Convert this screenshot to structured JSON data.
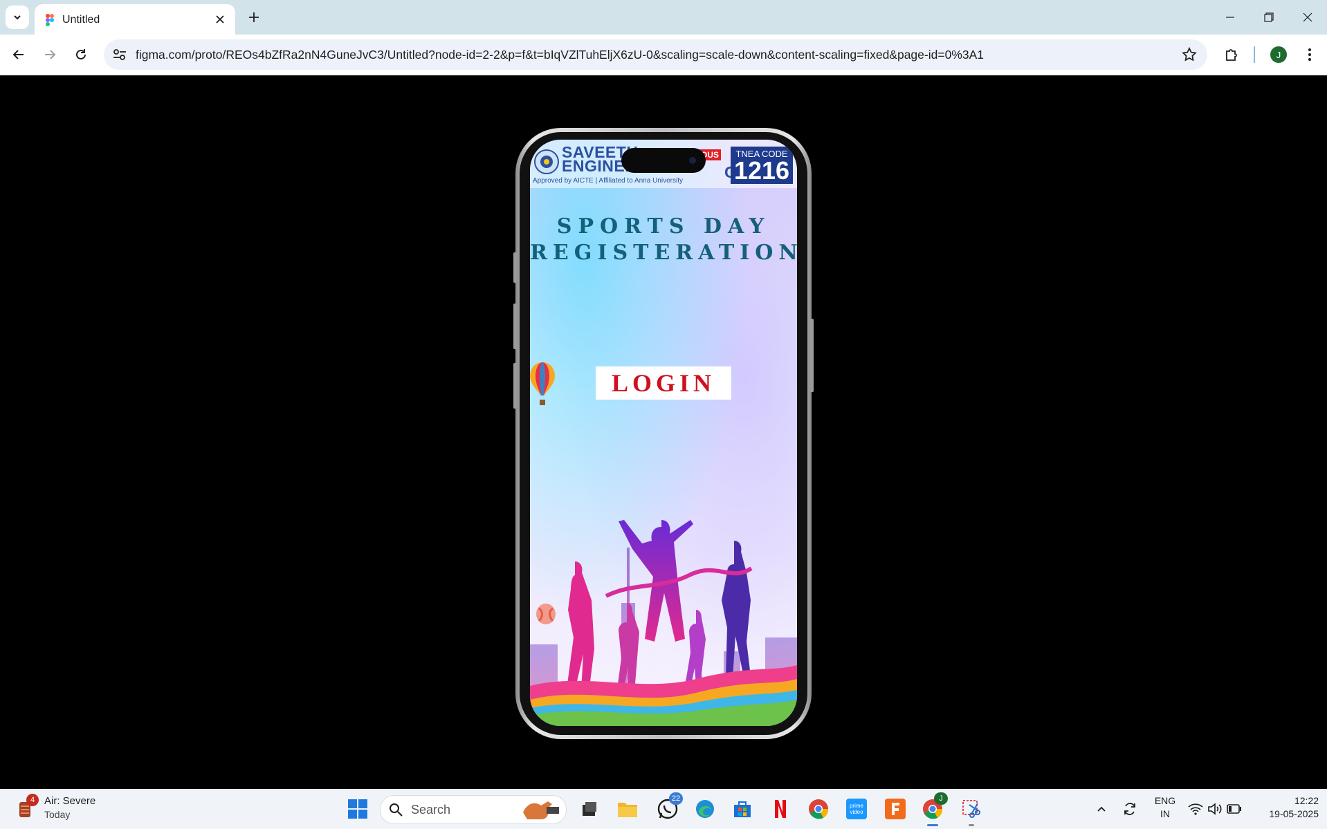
{
  "browser": {
    "tab_title": "Untitled",
    "url": "figma.com/proto/REOs4bZfRa2nN4GuneJvC3/Untitled?node-id=2-2&p=f&t=bIqVZlTuhEljX6zU-0&scaling=scale-down&content-scaling=fixed&page-id=0%3A1",
    "profile_initial": "J"
  },
  "phone_screen": {
    "college": {
      "name_line1": "SAVEETH",
      "name_line2": "ENGINEE",
      "name_end": "GE",
      "autonomous_fragment": "OUS",
      "approved_text": "Approved by AICTE  |  Affiliated to Anna University",
      "tnea_label": "TNEA CODE",
      "tnea_code": "1216"
    },
    "headline_line1": "SPORTS DAY",
    "headline_line2": "REGISTERATION",
    "login_label": "LOGIN"
  },
  "taskbar": {
    "weather_badge": "4",
    "weather_title": "Air: Severe",
    "weather_sub": "Today",
    "search_placeholder": "Search",
    "whatsapp_badge": "22",
    "chrome_badge": "J",
    "lang_line1": "ENG",
    "lang_line2": "IN",
    "time": "12:22",
    "date": "19-05-2025"
  },
  "colors": {
    "headline": "#14607a",
    "login_text": "#d0101e",
    "tnea_bg": "#1d3a8c",
    "tabbar": "#d3e3ea"
  }
}
